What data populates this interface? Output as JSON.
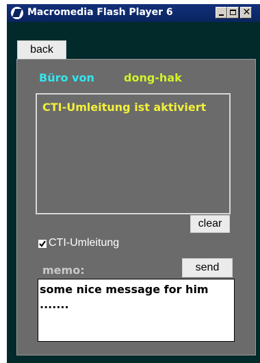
{
  "window": {
    "title": "Macromedia Flash Player 6"
  },
  "colors": {
    "title_bar": "#0a2460",
    "stage": "#032a2b",
    "panel": "#6b6b6b",
    "office_label": "#33e6ee",
    "user_name": "#d4f22a",
    "message_text": "#f2f03a"
  },
  "tab": {
    "back_label": "back"
  },
  "header": {
    "office_label": "Büro von",
    "user_name": "dong-hak"
  },
  "message": {
    "text": "CTI-Umleitung ist aktiviert"
  },
  "buttons": {
    "clear": "clear",
    "send": "send"
  },
  "redirect": {
    "label": "CTI-Umleitung",
    "checked": true
  },
  "memo": {
    "label": "memo:",
    "text": "some nice message for him\n......."
  }
}
